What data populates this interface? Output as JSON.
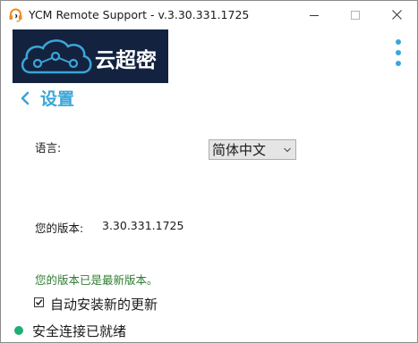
{
  "window": {
    "title": "YCM Remote Support - v.3.30.331.1725",
    "icon": "headset-icon"
  },
  "logo": {
    "text": "云超密",
    "background": "#13223f"
  },
  "header": {
    "menu_icon": "vertical-dots-icon",
    "accent_color": "#3aa6d8"
  },
  "page": {
    "title": "设置",
    "back_icon": "chevron-left-icon"
  },
  "settings": {
    "language_label": "语言:",
    "language_selected": "简体中文",
    "version_label": "您的版本:",
    "version_value": "3.30.331.1725",
    "version_status": "您的版本已是最新版本。",
    "version_status_color": "#2f7d32",
    "auto_update_label": "自动安装新的更新",
    "auto_update_checked": true
  },
  "status": {
    "text": "安全连接已就绪",
    "indicator_color": "#1fae74"
  }
}
